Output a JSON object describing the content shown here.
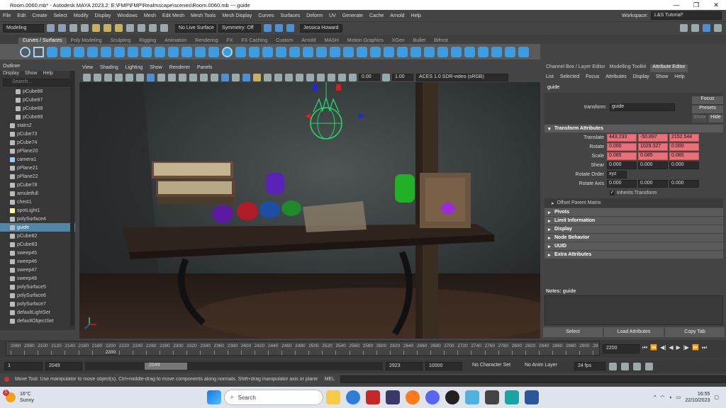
{
  "window": {
    "title": "Room.0060.mb* - Autodesk MAYA 2023.2: E:\\FMP\\FMP\\Realmscape\\scenes\\Room.0060.mb  ---  guide",
    "controls": [
      "—",
      "❐",
      "✕"
    ]
  },
  "menubar": {
    "items": [
      "File",
      "Edit",
      "Create",
      "Select",
      "Modify",
      "Display",
      "Windows",
      "Mesh",
      "Edit Mesh",
      "Mesh Tools",
      "Mesh Display",
      "Curves",
      "Surfaces",
      "Deform",
      "UV",
      "Generate",
      "Cache",
      "Arnold",
      "Help"
    ],
    "workspace_label": "Workspace:",
    "workspace_value": "L&S Tutorial*"
  },
  "statusline": {
    "mode": "Modeling",
    "live_surface": "No Live Surface",
    "symmetry": "Symmetry: Off",
    "user": "Jessica Howard"
  },
  "shelf_tabs": [
    "Curves / Surfaces",
    "Poly Modeling",
    "Sculpting",
    "Rigging",
    "Animation",
    "Rendering",
    "FX",
    "FX Caching",
    "Custom",
    "Arnold",
    "MASH",
    "Motion Graphics",
    "XGen",
    "Bullet",
    "Bifrost"
  ],
  "outliner": {
    "title": "Outliner",
    "menus": [
      "Display",
      "Show",
      "Help"
    ],
    "search_placeholder": "Search...",
    "items": [
      {
        "name": "pCube86",
        "level": 2
      },
      {
        "name": "pCube87",
        "level": 2
      },
      {
        "name": "pCube88",
        "level": 2
      },
      {
        "name": "pCube89",
        "level": 2
      },
      {
        "name": "stairs2",
        "level": 1
      },
      {
        "name": "pCube73",
        "level": 1
      },
      {
        "name": "pCube74",
        "level": 1
      },
      {
        "name": "pPlane20",
        "level": 1
      },
      {
        "name": "camera1",
        "level": 1
      },
      {
        "name": "pPlane21",
        "level": 1
      },
      {
        "name": "pPlane22",
        "level": 1
      },
      {
        "name": "pCube78",
        "level": 1
      },
      {
        "name": "amuletfull",
        "level": 1
      },
      {
        "name": "chest1",
        "level": 1
      },
      {
        "name": "spotLight1",
        "level": 1
      },
      {
        "name": "polySurface4",
        "level": 1
      },
      {
        "name": "guide",
        "level": 1,
        "selected": true
      },
      {
        "name": "pCube82",
        "level": 1
      },
      {
        "name": "pCube83",
        "level": 1
      },
      {
        "name": "sweep45",
        "level": 1
      },
      {
        "name": "sweep46",
        "level": 1
      },
      {
        "name": "sweep47",
        "level": 1
      },
      {
        "name": "sweep48",
        "level": 1
      },
      {
        "name": "polySurface5",
        "level": 1
      },
      {
        "name": "polySurface6",
        "level": 1
      },
      {
        "name": "polySurface7",
        "level": 1
      },
      {
        "name": "defaultLightSet",
        "level": 1
      },
      {
        "name": "defaultObjectSet",
        "level": 1
      }
    ]
  },
  "viewport": {
    "menus": [
      "View",
      "Shading",
      "Lighting",
      "Show",
      "Renderer",
      "Panels"
    ],
    "field1": "0.00",
    "field2": "1.00",
    "colorspace": "ACES 1.0 SDR-video (sRGB)"
  },
  "attribute_editor": {
    "tabs": [
      "Channel Box / Layer Editor",
      "Modelling Toolkit",
      "Attribute Editor"
    ],
    "menus": [
      "List",
      "Selected",
      "Focus",
      "Attributes",
      "Display",
      "Show",
      "Help"
    ],
    "node_tab": "guide",
    "transform_label": "transform:",
    "transform_value": "guide",
    "focus_btn": "Focus",
    "presets_btn": "Presets",
    "show_btn": "Show",
    "hide_btn": "Hide",
    "section_transform": "Transform Attributes",
    "translate_label": "Translate",
    "translate": [
      "443.233",
      "-50.897",
      "2152.544"
    ],
    "rotate_label": "Rotate",
    "rotate": [
      "0.000",
      "1029.327",
      "0.000"
    ],
    "scale_label": "Scale",
    "scale": [
      "0.085",
      "0.085",
      "0.085"
    ],
    "shear_label": "Shear",
    "shear": [
      "0.000",
      "0.000",
      "0.000"
    ],
    "rotate_order_label": "Rotate Order",
    "rotate_order": "xyz",
    "rotate_axis_label": "Rotate Axis",
    "rotate_axis": [
      "0.000",
      "0.000",
      "0.000"
    ],
    "inherits": "Inherits Transform",
    "offset_parent": "Offset Parent Matrix",
    "sections": [
      "Pivots",
      "Limit Information",
      "Display",
      "Node Behavior",
      "UUID",
      "Extra Attributes"
    ],
    "notes_label": "Notes: guide",
    "btn_select": "Select",
    "btn_load": "Load Attributes",
    "btn_copy": "Copy Tab"
  },
  "timeline": {
    "ticks": [
      "2060",
      "2080",
      "2100",
      "2120",
      "2140",
      "2160",
      "2180",
      "2200",
      "2220",
      "2240",
      "2260",
      "2280",
      "2300",
      "2320",
      "2340",
      "2360",
      "2380",
      "2400",
      "2420",
      "2440",
      "2460",
      "2480",
      "2500",
      "2520",
      "2540",
      "2560",
      "2580",
      "2600",
      "2620",
      "2640",
      "2660",
      "2680",
      "2700",
      "2720",
      "2740",
      "2760",
      "2780",
      "2800",
      "2820",
      "2840",
      "2860",
      "2880",
      "2900",
      "29"
    ],
    "current_marker": "2200",
    "current_frame": "2200"
  },
  "range": {
    "start": "1",
    "range_start": "2049",
    "range_inner": "2049",
    "range_end": "2923",
    "end": "10000",
    "character_set": "No Character Set",
    "anim_layer": "No Anim Layer",
    "fps": "24 fps"
  },
  "helpline": {
    "text": "Move Tool: Use manipulator to move object(s). Ctrl+middle-drag to move components along normals. Shift+drag manipulator axis or plane handles to ext",
    "mel": "MEL"
  },
  "taskbar": {
    "temp": "16°C",
    "weather": "Sunny",
    "search": "Search",
    "time": "16:55",
    "date": "22/10/2023",
    "badge": "1"
  }
}
